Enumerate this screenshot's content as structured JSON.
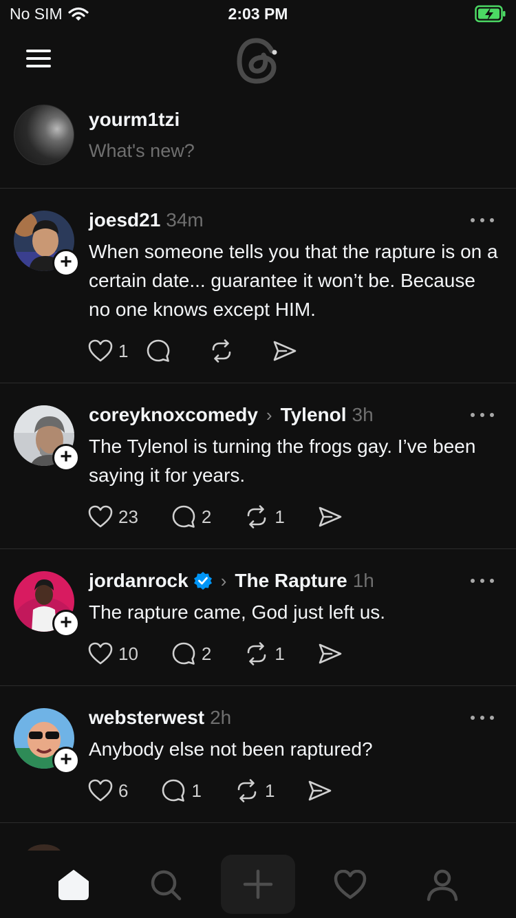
{
  "status": {
    "carrier": "No SIM",
    "time": "2:03 PM"
  },
  "composer": {
    "username": "yourm1tzi",
    "placeholder": "What's new?"
  },
  "posts": [
    {
      "username": "joesd21",
      "topic": "",
      "time": "34m",
      "text": "When someone tells you that the rapture is on a certain date... guarantee it won’t be. Because no one knows except HIM.",
      "likes": "1",
      "replies": "",
      "reposts": ""
    },
    {
      "username": "coreyknoxcomedy",
      "topic": "Tylenol",
      "time": "3h",
      "text": "The Tylenol is turning the frogs gay. I’ve been saying it for years.",
      "likes": "23",
      "replies": "2",
      "reposts": "1"
    },
    {
      "username": "jordanrock",
      "topic": "The Rapture",
      "time": "1h",
      "verified": true,
      "text": "The rapture came, God just left us.",
      "likes": "10",
      "replies": "2",
      "reposts": "1"
    },
    {
      "username": "websterwest",
      "topic": "",
      "time": "2h",
      "text": "Anybody else not been raptured?",
      "likes": "6",
      "replies": "1",
      "reposts": "1"
    }
  ],
  "tabs": [
    "home-icon",
    "search-icon",
    "plus-icon",
    "heart-icon",
    "profile-icon"
  ],
  "colors": {
    "background": "#101010",
    "text": "#f3f5f7",
    "muted": "#6f6f6f",
    "verified": "#0095f6"
  }
}
